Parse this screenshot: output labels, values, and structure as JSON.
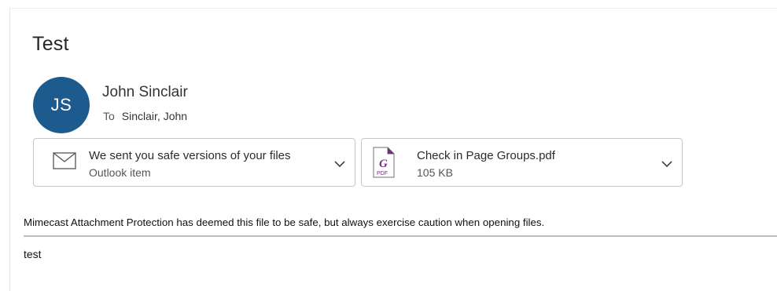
{
  "message": {
    "subject": "Test",
    "sender": {
      "initials": "JS",
      "name": "John Sinclair",
      "to_label": "To",
      "to_value": "Sinclair, John",
      "avatar_color": "#1d5a8e"
    },
    "attachments": [
      {
        "title": "We sent you safe versions of your files",
        "subtitle": "Outlook item",
        "icon": "envelope-icon"
      },
      {
        "title": "Check in Page Groups.pdf",
        "subtitle": "105 KB",
        "icon": "pdf-file-icon",
        "icon_badge": "PDF"
      }
    ],
    "banner": "Mimecast Attachment Protection has deemed this file to be safe, but always exercise caution when opening files.",
    "body": "test"
  }
}
